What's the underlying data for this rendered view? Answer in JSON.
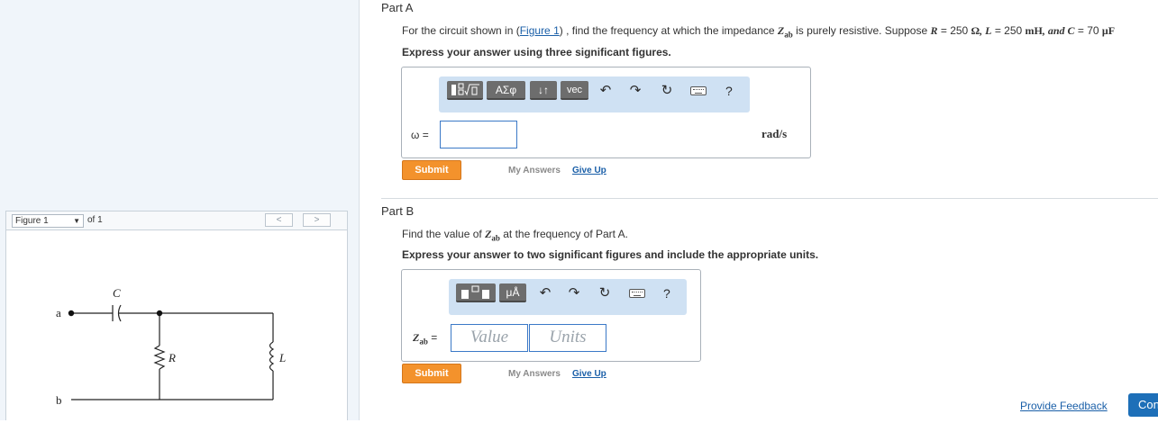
{
  "figure": {
    "select_value": "Figure 1",
    "of_label": "of 1",
    "prev_label": "<",
    "next_label": ">",
    "circuit": {
      "node_a": "a",
      "node_b": "b",
      "capacitor": "C",
      "resistor": "R",
      "inductor": "L"
    }
  },
  "partA": {
    "title": "Part A",
    "prompt_pre": "For the circuit shown in (",
    "figure_link": "Figure 1",
    "prompt_mid": ") , find the frequency at which the impedance ",
    "z_sym": "Z",
    "z_sub": "ab",
    "prompt_mid2": " is purely resistive. Suppose ",
    "r_sym": "R",
    "r_val": " = 250 ",
    "r_unit": "Ω",
    "l_sym": ", L",
    "l_val": " = 250 ",
    "l_unit": "mH",
    "c_sym": ", and C",
    "c_val": " = 70 ",
    "c_unit": "μF",
    "instruction": "Express your answer using three significant figures.",
    "toolbar": {
      "templates_icon": "fraction-root-templates-icon",
      "greek_label": "ΑΣφ",
      "updown_label": "↓↑",
      "vec_label": "vec",
      "help_label": "?"
    },
    "variable": "ω =",
    "input_value": "",
    "unit": "rad/s",
    "submit_label": "Submit",
    "my_answers": "My Answers",
    "give_up": "Give Up"
  },
  "partB": {
    "title": "Part B",
    "prompt_pre": "Find the value of ",
    "z_sym": "Z",
    "z_sub": "ab",
    "prompt_post": " at the frequency of Part A.",
    "instruction": "Express your answer to two significant figures and include the appropriate units.",
    "toolbar": {
      "templates_icon": "value-units-template-icon",
      "units_label": "μÅ",
      "help_label": "?"
    },
    "variable_sym": "Z",
    "variable_sub": "ab",
    "variable_eq": " =",
    "value_placeholder": "Value",
    "units_placeholder": "Units",
    "submit_label": "Submit",
    "my_answers": "My Answers",
    "give_up": "Give Up"
  },
  "footer": {
    "feedback": "Provide Feedback",
    "continue": "Continue"
  },
  "colors": {
    "accent": "#1a5fa8",
    "submit": "#f3922c",
    "toolbar_bg": "#cfe1f3",
    "panel_bg": "#f0f5fa"
  }
}
